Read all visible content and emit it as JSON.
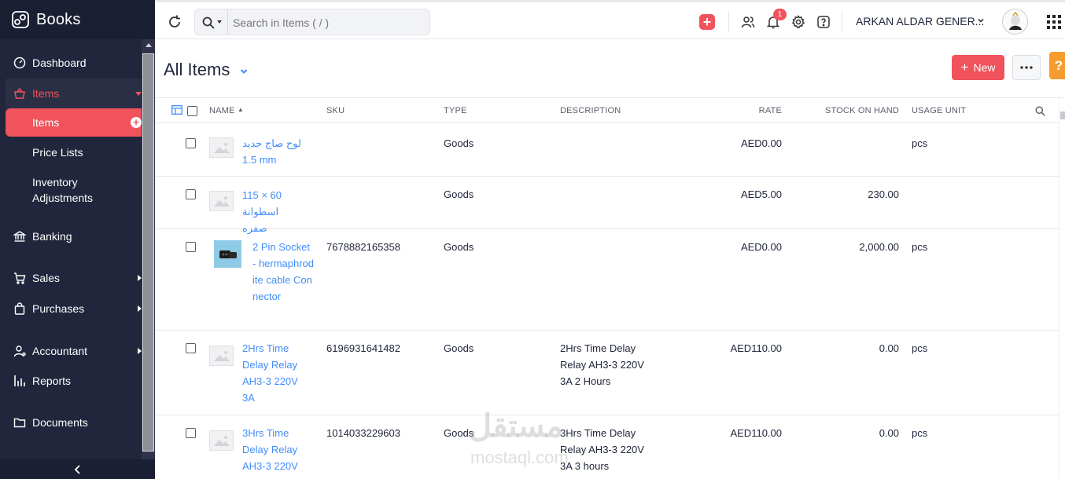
{
  "app": {
    "name": "Books"
  },
  "sidebar": {
    "items": [
      {
        "label": "Dashboard"
      },
      {
        "label": "Items"
      },
      {
        "label": "Items"
      },
      {
        "label": "Price Lists"
      },
      {
        "label": "Inventory Adjustments"
      },
      {
        "label": "Banking"
      },
      {
        "label": "Sales"
      },
      {
        "label": "Purchases"
      },
      {
        "label": "Accountant"
      },
      {
        "label": "Reports"
      },
      {
        "label": "Documents"
      }
    ]
  },
  "header": {
    "search_placeholder": "Search in Items ( / )",
    "notification_count": "1",
    "organization": "ARKAN ALDAR GENER..."
  },
  "page": {
    "title": "All Items",
    "new_label": "New",
    "help_label": "?"
  },
  "table": {
    "columns": [
      "NAME",
      "SKU",
      "TYPE",
      "DESCRIPTION",
      "RATE",
      "STOCK ON HAND",
      "USAGE UNIT"
    ],
    "rows": [
      {
        "name": "لوح صاج حديد 1.5 mm",
        "sku": "",
        "type": "Goods",
        "description": "",
        "rate": "AED0.00",
        "stock": "",
        "unit": "pcs",
        "image": "placeholder"
      },
      {
        "name": "115 × 60 اسطوانة صفره",
        "sku": "",
        "type": "Goods",
        "description": "",
        "rate": "AED5.00",
        "stock": "230.00",
        "unit": "",
        "image": "placeholder"
      },
      {
        "name": "2 Pin Socket - hermaphrodite cable Connector",
        "sku": "7678882165358",
        "type": "Goods",
        "description": "",
        "rate": "AED0.00",
        "stock": "2,000.00",
        "unit": "pcs",
        "image": "photo"
      },
      {
        "name": "2Hrs Time Delay Relay AH3-3 220V 3A",
        "sku": "6196931641482",
        "type": "Goods",
        "description": "2Hrs Time Delay Relay AH3-3 220V 3A 2 Hours",
        "rate": "AED110.00",
        "stock": "0.00",
        "unit": "pcs",
        "image": "placeholder"
      },
      {
        "name": "3Hrs Time Delay Relay AH3-3 220V",
        "sku": "1014033229603",
        "type": "Goods",
        "description": "3Hrs Time Delay Relay AH3-3 220V 3A 3 hours",
        "rate": "AED110.00",
        "stock": "0.00",
        "unit": "pcs",
        "image": "placeholder"
      }
    ]
  },
  "watermark": {
    "text": "مستقل",
    "sub": "mostaql.com"
  },
  "colors": {
    "sidebar_bg": "#21263c",
    "accent": "#f0535b",
    "link": "#408dfb",
    "help": "#f69b2d"
  }
}
